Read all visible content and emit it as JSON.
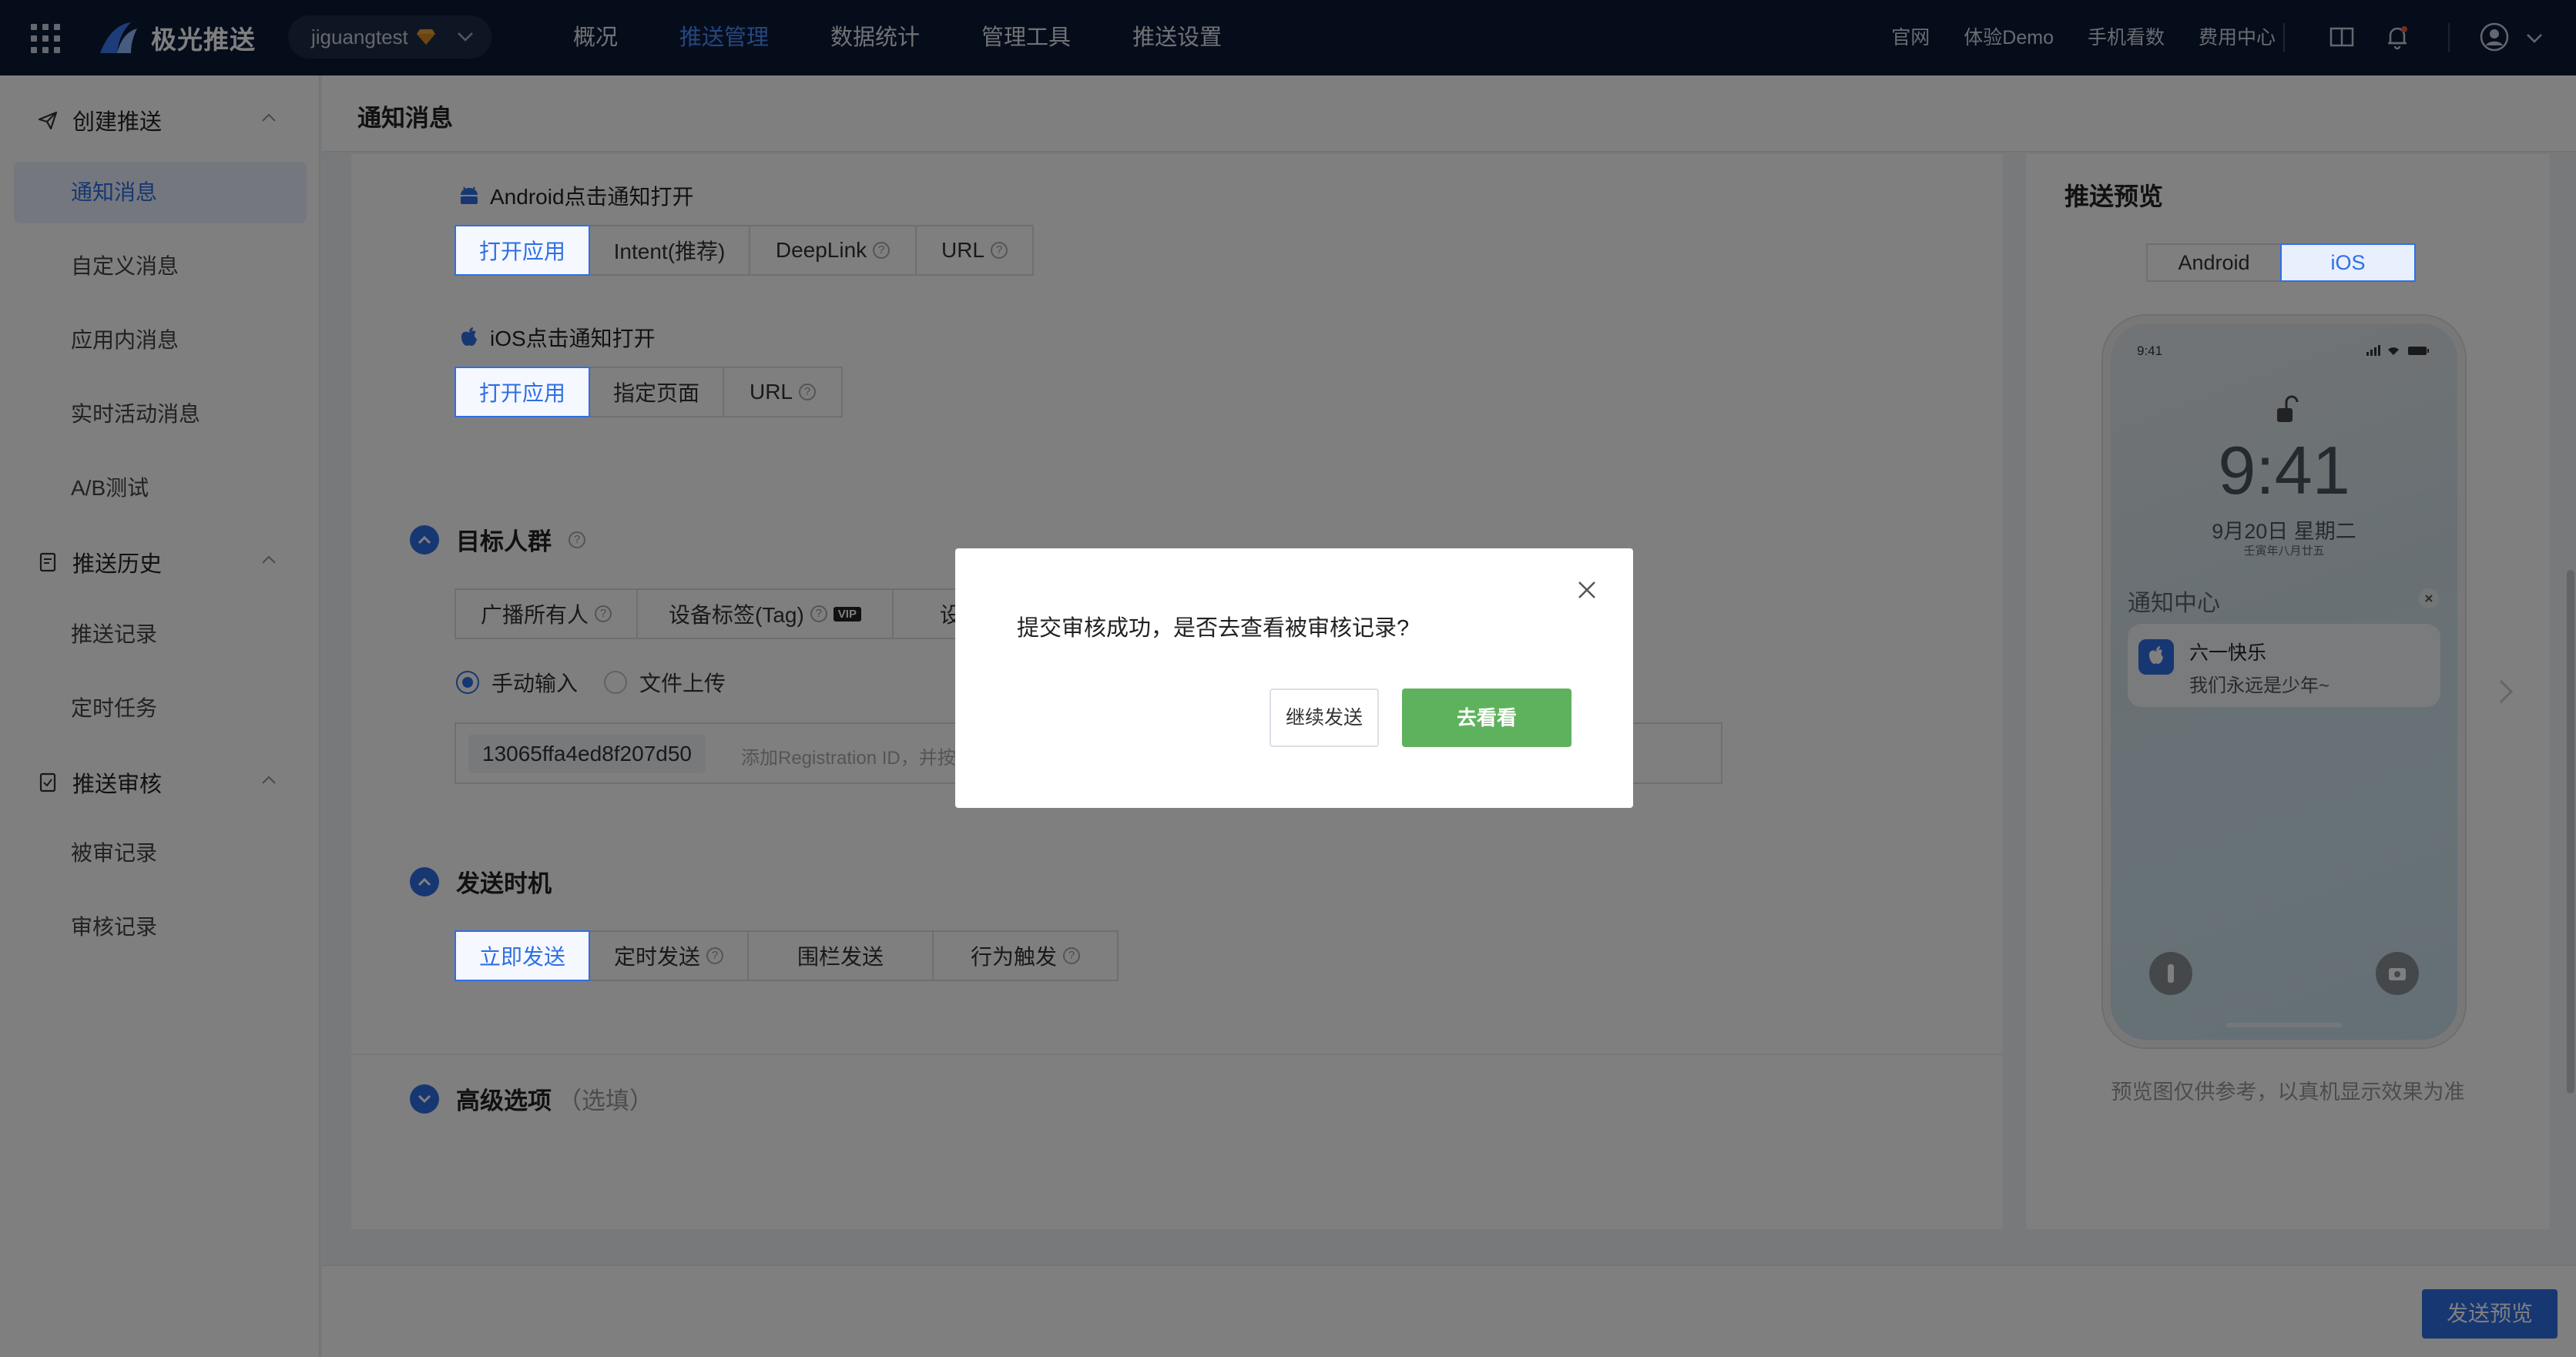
{
  "header": {
    "app_name": "极光推送",
    "account": "jiguangtest",
    "nav": [
      "概况",
      "推送管理",
      "数据统计",
      "管理工具",
      "推送设置"
    ],
    "links": [
      "官网",
      "体验Demo",
      "手机看数",
      "费用中心"
    ]
  },
  "sidebar": {
    "groups": [
      {
        "label": "创建推送",
        "items": [
          "通知消息",
          "自定义消息",
          "应用内消息",
          "实时活动消息",
          "A/B测试"
        ]
      },
      {
        "label": "推送历史",
        "items": [
          "推送记录",
          "定时任务"
        ]
      },
      {
        "label": "推送审核",
        "items": [
          "被审记录",
          "审核记录"
        ]
      }
    ]
  },
  "page": {
    "title": "通知消息",
    "android_click": {
      "label": "Android点击通知打开",
      "options": [
        "打开应用",
        "Intent(推荐)",
        "DeepLink",
        "URL"
      ]
    },
    "ios_click": {
      "label": "iOS点击通知打开",
      "options": [
        "打开应用",
        "指定页面",
        "URL"
      ]
    },
    "target": {
      "title": "目标人群",
      "options": [
        "广播所有人",
        "设备标签(Tag)",
        "设备"
      ],
      "vip": "VIP",
      "input_modes": [
        "手动输入",
        "文件上传"
      ],
      "registration_id": "13065ffa4ed8f207d50",
      "placeholder": "添加Registration ID，并按"
    },
    "timing": {
      "title": "发送时机",
      "options": [
        "立即发送",
        "定时发送",
        "围栏发送",
        "行为触发"
      ]
    },
    "advanced": {
      "title": "高级选项",
      "optional": "（选填）"
    }
  },
  "preview": {
    "title": "推送预览",
    "tabs": [
      "Android",
      "iOS"
    ],
    "status_time": "9:41",
    "clock": "9:41",
    "date": "9月20日 星期二",
    "lunar": "壬寅年八月廿五",
    "notification_center": "通知中心",
    "notification": {
      "title": "六一快乐",
      "body": "我们永远是少年~"
    },
    "note": "预览图仅供参考，以真机显示效果为准"
  },
  "footer": {
    "send_preview": "发送预览"
  },
  "dialog": {
    "message": "提交审核成功，是否去查看被审核记录?",
    "continue_label": "继续发送",
    "go_label": "去看看"
  },
  "colors": {
    "primary": "#2f6fe4",
    "topbar": "#0b1b36",
    "success": "#5fb25d"
  }
}
